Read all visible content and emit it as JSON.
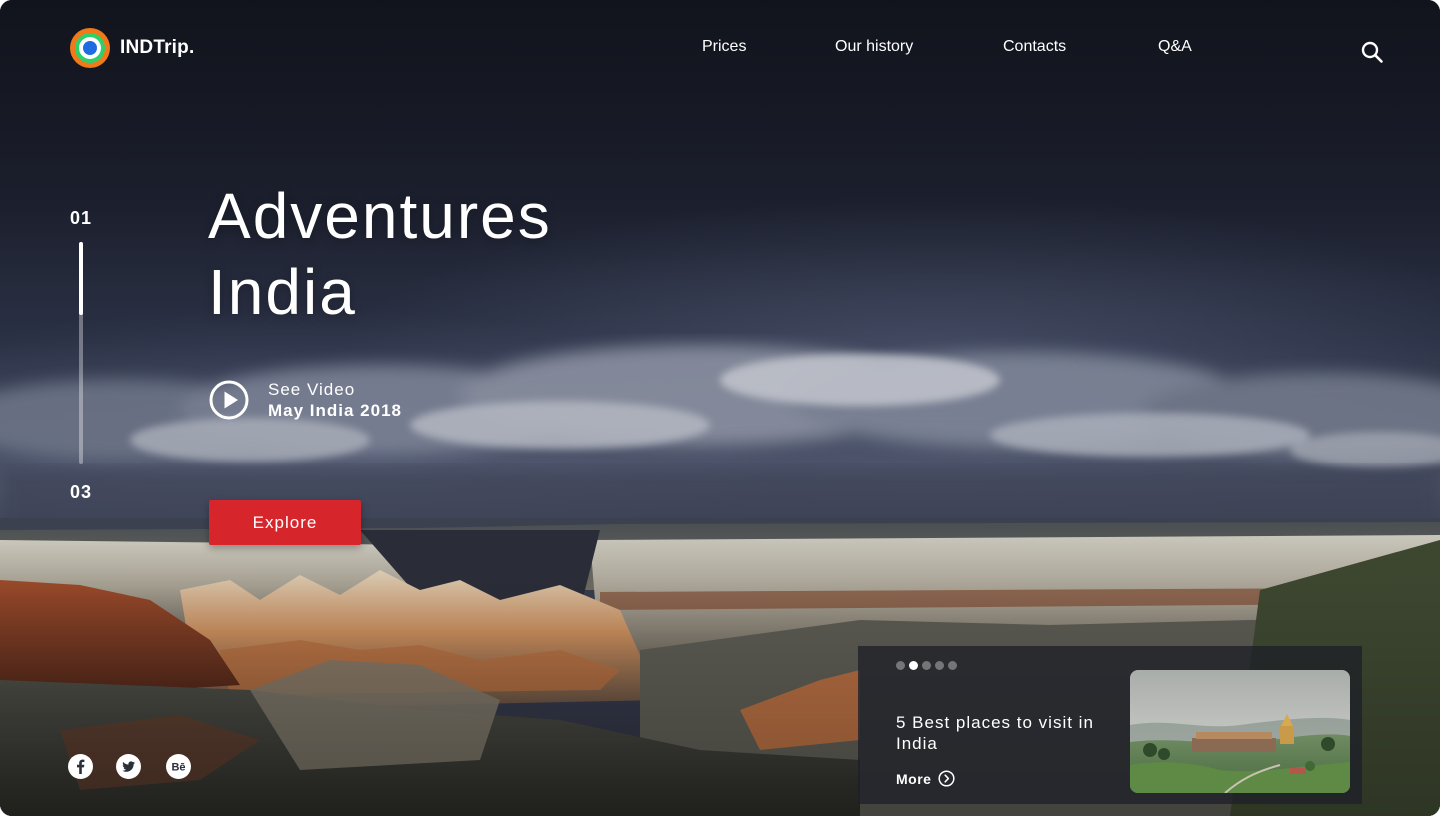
{
  "brand": {
    "name": "INDTrip."
  },
  "nav": {
    "items": [
      {
        "label": "Prices"
      },
      {
        "label": "Our history"
      },
      {
        "label": "Contacts"
      },
      {
        "label": "Q&A"
      }
    ]
  },
  "slider": {
    "current": "01",
    "total": "03",
    "progress": 0.33
  },
  "hero": {
    "title_line1": "Adventures",
    "title_line2": "India",
    "video_label": "See Video",
    "video_subtitle": "May India 2018",
    "cta_label": "Explore"
  },
  "socials": [
    {
      "icon": "facebook-icon"
    },
    {
      "icon": "twitter-icon"
    },
    {
      "icon": "behance-icon"
    }
  ],
  "card": {
    "dots_total": 5,
    "dots_active": 2,
    "title": "5 Best places to visit in India",
    "more_label": "More"
  },
  "colors": {
    "accent_red": "#d6262b",
    "logo_orange": "#f07a1a",
    "logo_green": "#2fd06a",
    "logo_blue": "#1f6ce0"
  }
}
